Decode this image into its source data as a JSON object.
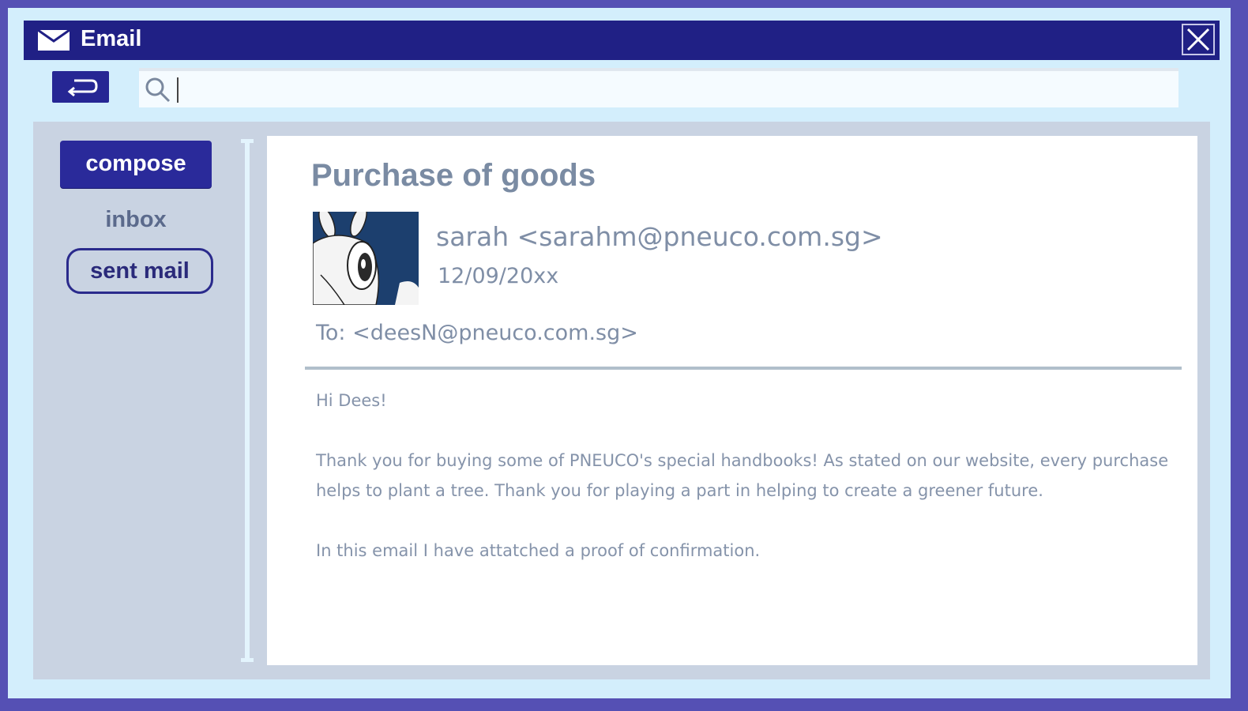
{
  "window": {
    "title": "Email",
    "icons": {
      "app": "envelope-icon",
      "close": "close-icon"
    }
  },
  "toolbar": {
    "back_icon": "return-arrow-icon",
    "search": {
      "placeholder": "",
      "value": "",
      "icon": "search-icon"
    }
  },
  "sidebar": {
    "compose_label": "compose",
    "items": [
      {
        "label": "inbox",
        "selected": false
      },
      {
        "label": "sent mail",
        "selected": true
      }
    ]
  },
  "email": {
    "subject": "Purchase of goods",
    "sender": "sarah <sarahm@pneuco.com.sg>",
    "date": "12/09/20xx",
    "to": "To: <deesN@pneuco.com.sg>",
    "body": {
      "greeting": "Hi Dees!",
      "paragraph1": "Thank you for buying some of PNEUCO's special handbooks! As stated on our website, every purchase helps to plant a tree. Thank you for playing a part in helping to create a greener future.",
      "paragraph2": "In this email I have attatched a proof of confirmation."
    }
  },
  "colors": {
    "titlebar": "#202085",
    "border": "#5550b4",
    "window_bg": "#d3eefc",
    "panel_bg": "#c9d3e2",
    "accent_button": "#2a2a9a",
    "text_muted": "#7f8ea6"
  }
}
